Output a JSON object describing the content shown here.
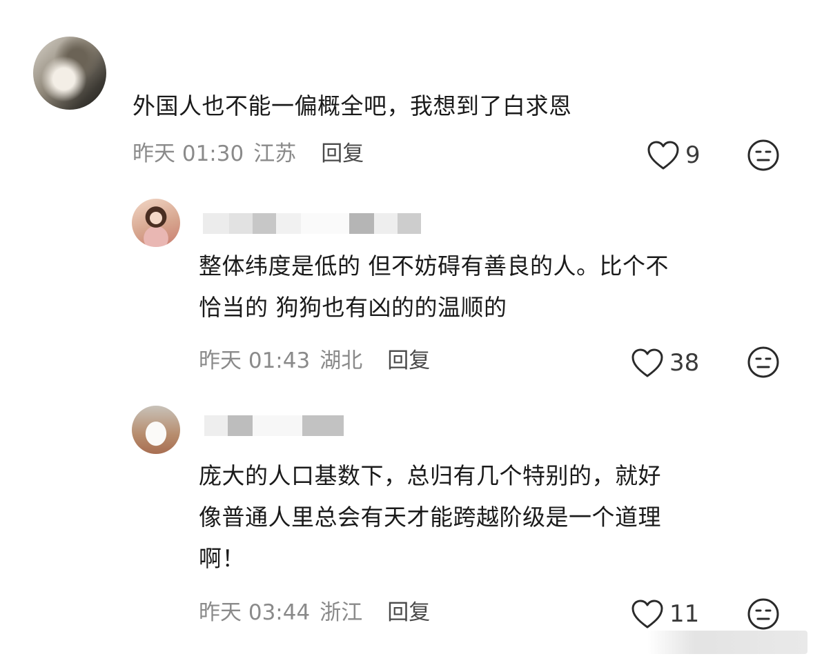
{
  "comments": [
    {
      "text": "外国人也不能一偏概全吧，我想到了白求恩",
      "time": "昨天 01:30",
      "location": "江苏",
      "reply_label": "回复",
      "likes": "9"
    },
    {
      "text_line1": "整体纬度是低的 但不妨碍有善良的人。比个不",
      "text_line2": "恰当的 狗狗也有凶的的温顺的",
      "time": "昨天 01:43",
      "location": "湖北",
      "reply_label": "回复",
      "likes": "38"
    },
    {
      "text_line1": "庞大的人口基数下，总归有几个特别的，就好",
      "text_line2": "像普通人里总会有天才能跨越阶级是一个道理",
      "text_line3": "啊！",
      "time": "昨天 03:44",
      "location": "浙江",
      "reply_label": "回复",
      "likes": "11"
    }
  ],
  "icons": {
    "like": "heart-outline-icon",
    "emoji": "neutral-face-icon"
  },
  "colors": {
    "text": "#1a1a1a",
    "meta": "#8a8a8a",
    "reply": "#4a4a4a",
    "icon": "#2a2a2a"
  }
}
